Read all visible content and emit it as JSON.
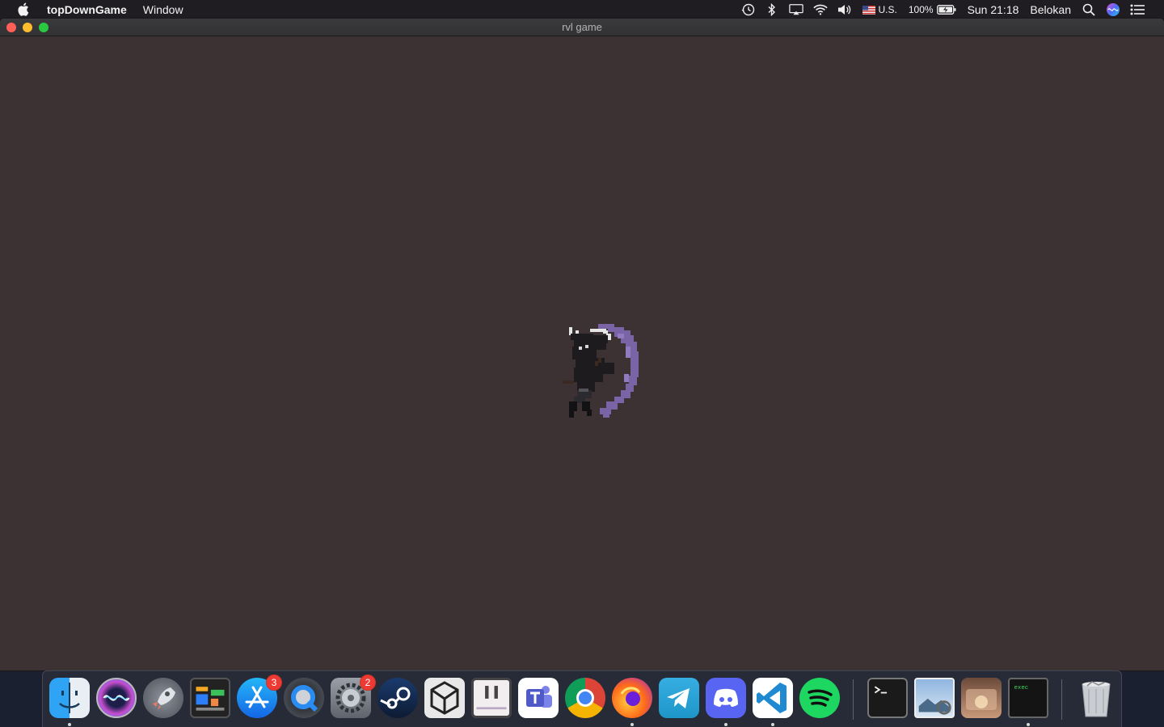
{
  "menubar": {
    "app_name": "topDownGame",
    "menus": [
      "Window"
    ],
    "input_source": "U.S.",
    "battery": "100%",
    "clock": "Sun 21:18",
    "user": "Belokan"
  },
  "window": {
    "title": "rvl game",
    "background": "#3c3233"
  },
  "dock": {
    "apps": [
      {
        "name": "Finder",
        "badge": null,
        "running": true
      },
      {
        "name": "Siri",
        "badge": null,
        "running": false
      },
      {
        "name": "Launchpad",
        "badge": null,
        "running": false
      },
      {
        "name": "Monitor",
        "badge": null,
        "running": false
      },
      {
        "name": "App Store",
        "badge": "3",
        "running": false
      },
      {
        "name": "QuickTime",
        "badge": null,
        "running": false
      },
      {
        "name": "System Preferences",
        "badge": "2",
        "running": false
      },
      {
        "name": "Steam",
        "badge": null,
        "running": false
      },
      {
        "name": "Unity Hub",
        "badge": null,
        "running": false
      },
      {
        "name": "itch",
        "badge": null,
        "running": false
      },
      {
        "name": "Teams",
        "badge": null,
        "running": false
      },
      {
        "name": "Chrome",
        "badge": null,
        "running": false
      },
      {
        "name": "Firefox",
        "badge": null,
        "running": true
      },
      {
        "name": "Telegram",
        "badge": null,
        "running": false
      },
      {
        "name": "Discord",
        "badge": null,
        "running": true
      },
      {
        "name": "VS Code",
        "badge": null,
        "running": true
      },
      {
        "name": "Spotify",
        "badge": null,
        "running": false
      },
      {
        "name": "Terminal",
        "badge": null,
        "running": false
      },
      {
        "name": "Preview",
        "badge": null,
        "running": false
      },
      {
        "name": "Folder",
        "badge": null,
        "running": false
      },
      {
        "name": "exec",
        "badge": null,
        "running": true
      },
      {
        "name": "Trash",
        "badge": null,
        "running": false
      }
    ],
    "exec_label": "exec"
  },
  "colors": {
    "scythe": "#7a64a6",
    "character": "#1e1b1e"
  }
}
